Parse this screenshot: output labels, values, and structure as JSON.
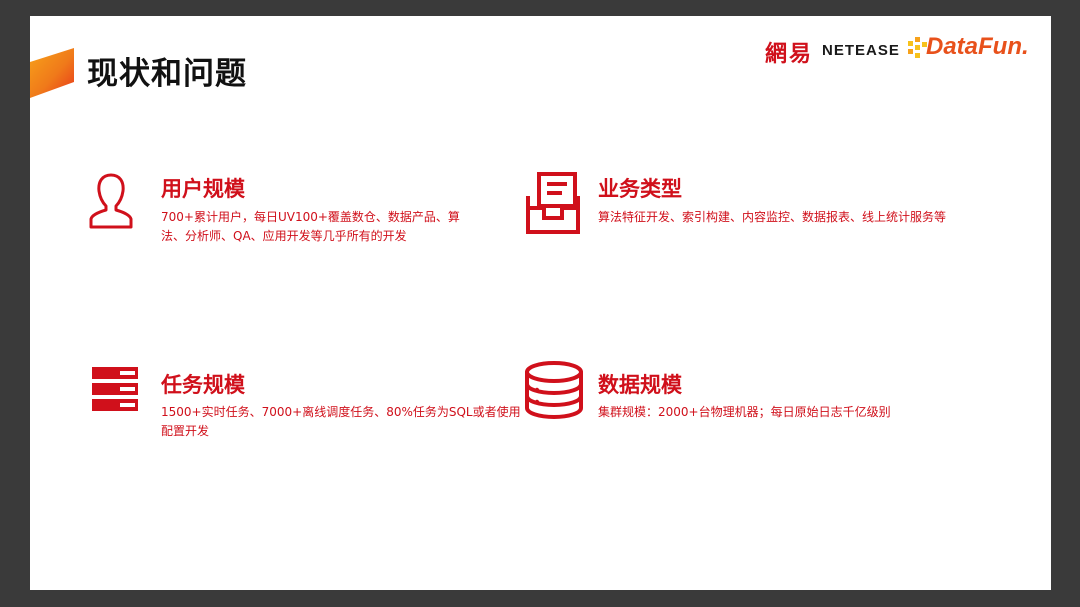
{
  "slide": {
    "title": "现状和问题"
  },
  "logos": {
    "netease_cn": "網易",
    "netease_en": "NETEASE",
    "datafun": "DataFun."
  },
  "colors": {
    "accent_red": "#d0101b",
    "accent_orange": "#f7a21b",
    "frame": "#3a3a3a"
  },
  "sections": [
    {
      "title": "用户规模",
      "icon": "user-icon",
      "description": "700+累计用户，每日UV100+覆盖数仓、数据产品、算法、分析师、QA、应用开发等几乎所有的开发"
    },
    {
      "title": "业务类型",
      "icon": "document-tray-icon",
      "description": "算法特征开发、索引构建、内容监控、数据报表、线上统计服务等"
    },
    {
      "title": "任务规模",
      "icon": "server-stack-icon",
      "description": "1500+实时任务、7000+离线调度任务、80%任务为SQL或者使用配置开发"
    },
    {
      "title": "数据规模",
      "icon": "database-icon",
      "description": "集群规模：2000+台物理机器；每日原始日志千亿级别"
    }
  ]
}
